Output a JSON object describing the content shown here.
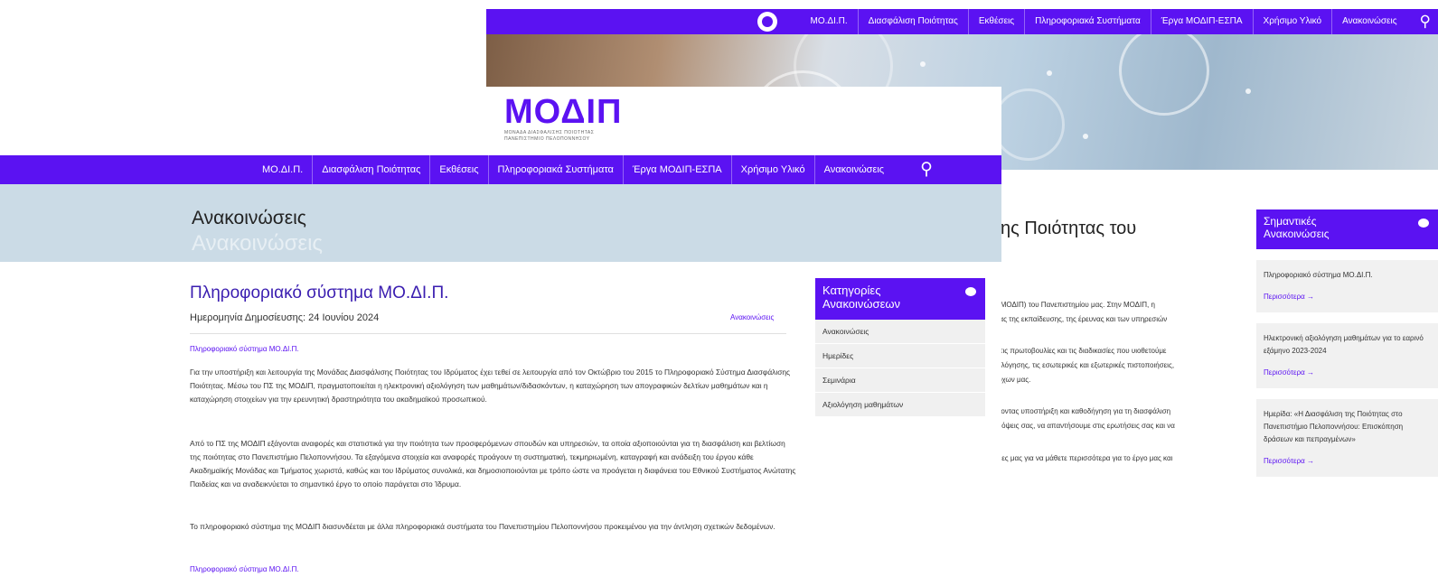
{
  "colors": {
    "brand": "#5b12f2",
    "banner": "#cbdbe6",
    "sidebar_bg": "#f0f0f0"
  },
  "back_window": {
    "nav_items": [
      "ΜΟ.ΔΙ.Π.",
      "Διασφάλιση Ποιότητας",
      "Εκθέσεις",
      "Πληροφοριακά Συστήματα",
      "Έργα ΜΟΔΙΠ-ΕΣΠΑ",
      "Χρήσιμο Υλικό",
      "Ανακοινώσεις"
    ],
    "heading": "ης Ποιότητας του",
    "paragraphs": [
      "ς (ΜΟΔΙΠ) του Πανεπιστημίου μας. Στην ΜΟΔΙΠ, η",
      "ητας της εκπαίδευσης, της έρευνας και των υπηρεσιών",
      "ς, τις πρωτοβουλίες και τις διαδικασίες που υιοθετούμε",
      "ξιολόγησης, τις εσωτερικές και εξωτερικές πιστοποιήσεις,",
      "ττόχων μας.",
      "ιέχοντας υποστήριξη και καθοδήγηση για τη διασφάλιση",
      "απόψεις σας, να απαντήσουμε στις ερωτήσεις σας και να",
      "λίδες μας για να μάθετε περισσότερα για το έργο μας και"
    ],
    "important": {
      "title_line1": "Σημαντικές",
      "title_line2": "Ανακοινώσεις",
      "cards": [
        {
          "text": "Πληροφοριακό σύστημα ΜΟ.ΔΙ.Π.",
          "more": "Περισσότερα →"
        },
        {
          "text": "Ηλεκτρονική αξιολόγηση μαθημάτων για το εαρινό εξάμηνο 2023-2024",
          "more": "Περισσότερα →"
        },
        {
          "text": "Ημερίδα: «Η Διασφάλιση της Ποιότητας στο Πανεπιστήμιο Πελοποννήσου: Επισκόπηση δράσεων και πεπραγμένων»",
          "more": "Περισσότερα →"
        }
      ]
    }
  },
  "front_window": {
    "logo": {
      "word": "ΜΟΔΙΠ",
      "sub1": "ΜΟΝΑΔΑ ΔΙΑΣΦΑΛΙΣΗΣ ΠΟΙΟΤΗΤΑΣ",
      "sub2": "ΠΑΝΕΠΙΣΤΗΜΙΟ ΠΕΛΟΠΟΝΝΗΣΟΥ"
    },
    "nav_items": [
      "ΜΟ.ΔΙ.Π.",
      "Διασφάλιση Ποιότητας",
      "Εκθέσεις",
      "Πληροφοριακά Συστήματα",
      "Έργα ΜΟΔΙΠ-ΕΣΠΑ",
      "Χρήσιμο Υλικό",
      "Ανακοινώσεις"
    ],
    "banner_title": "Ανακοινώσεις",
    "banner_ghost": "Ανακοινώσεις",
    "post": {
      "title": "Πληροφοριακό σύστημα ΜΟ.ΔΙ.Π.",
      "meta": "Ημερομηνία Δημοσίευσης:  24 Ιουνίου 2024",
      "category": "Ανακοινώσεις",
      "link_top": "Πληροφοριακό σύστημα ΜΟ.ΔΙ.Π.",
      "p1": "Για την υποστήριξη και λειτουργία της Μονάδας Διασφάλισης Ποιότητας του Ιδρύματος έχει τεθεί σε λειτουργία από τον Οκτώβριο του 2015 το Πληροφοριακό Σύστημα Διασφάλισης Ποιότητας. Μέσω του ΠΣ της ΜΟΔΙΠ, πραγματοποιείται η ηλεκτρονική αξιολόγηση των μαθημάτων/διδασκόντων, η καταχώρηση των απογραφικών δελτίων μαθημάτων και η καταχώρηση στοιχείων για την ερευνητική δραστηριότητα του ακαδημαϊκού προσωπικού.",
      "p2": "Από το ΠΣ της ΜΟΔΙΠ εξάγονται αναφορές και στατιστικά για την ποιότητα των προσφερόμενων σπουδών και υπηρεσιών, τα οποία αξιοποιούνται για τη διασφάλιση και βελτίωση της ποιότητας στο Πανεπιστήμιο Πελοποννήσου. Τα εξαγόμενα στοιχεία και αναφορές προάγουν τη συστηματική, τεκμηριωμένη, καταγραφή και ανάδειξη του έργου κάθε Ακαδημαϊκής Μονάδας και Τμήματος χωριστά, καθώς και του Ιδρύματος συνολικά, και δημοσιοποιούνται με τρόπο ώστε να προάγεται η διαφάνεια του Εθνικού Συστήματος Ανώτατης Παιδείας και να αναδεικνύεται το σημαντικό έργο το οποίο παράγεται στο Ίδρυμα.",
      "p3": "Το πληροφοριακό σύστημα της ΜΟΔΙΠ διασυνδέεται με άλλα πληροφοριακά συστήματα του Πανεπιστημίου Πελοποννήσου προκειμένου για την άντληση σχετικών δεδομένων.",
      "link_bottom": "Πληροφοριακό σύστημα ΜΟ.ΔΙ.Π."
    },
    "categories": {
      "title_line1": "Κατηγορίες",
      "title_line2": "Ανακοινώσεων",
      "items": [
        "Ανακοινώσεις",
        "Ημερίδες",
        "Σεμινάρια",
        "Αξιολόγηση μαθημάτων"
      ]
    }
  }
}
